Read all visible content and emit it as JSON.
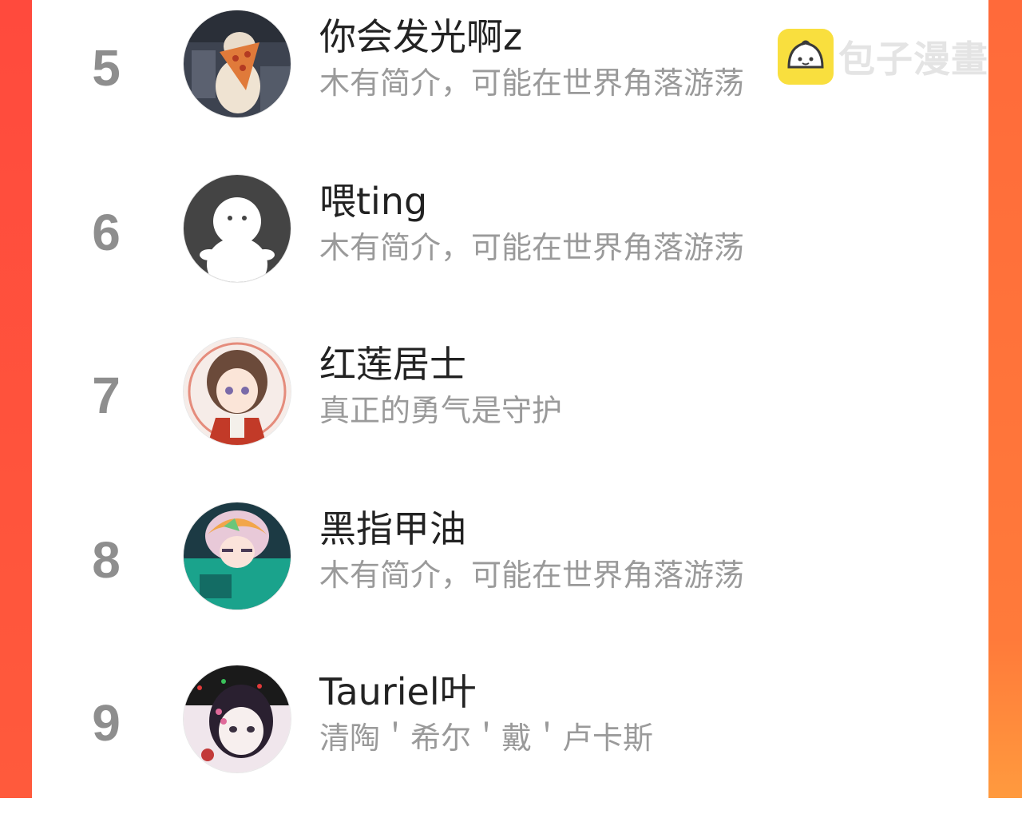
{
  "watermark": {
    "text": "包子漫畫"
  },
  "ranking": [
    {
      "rank": "5",
      "name": "你会发光啊z",
      "bio": "木有简介，可能在世界角落游荡"
    },
    {
      "rank": "6",
      "name": "喂ting",
      "bio": "木有简介，可能在世界角落游荡"
    },
    {
      "rank": "7",
      "name": "红莲居士",
      "bio": "真正的勇气是守护"
    },
    {
      "rank": "8",
      "name": "黑指甲油",
      "bio": "木有简介，可能在世界角落游荡"
    },
    {
      "rank": "9",
      "name": "Tauriel叶",
      "bio": "清陶＇希尔＇戴＇卢卡斯"
    }
  ],
  "colors": {
    "accent_left": "#ff4a3d",
    "accent_right": "#ff7a3a",
    "rank_text": "#8e8e8e",
    "bio_text": "#9a9a9a"
  }
}
